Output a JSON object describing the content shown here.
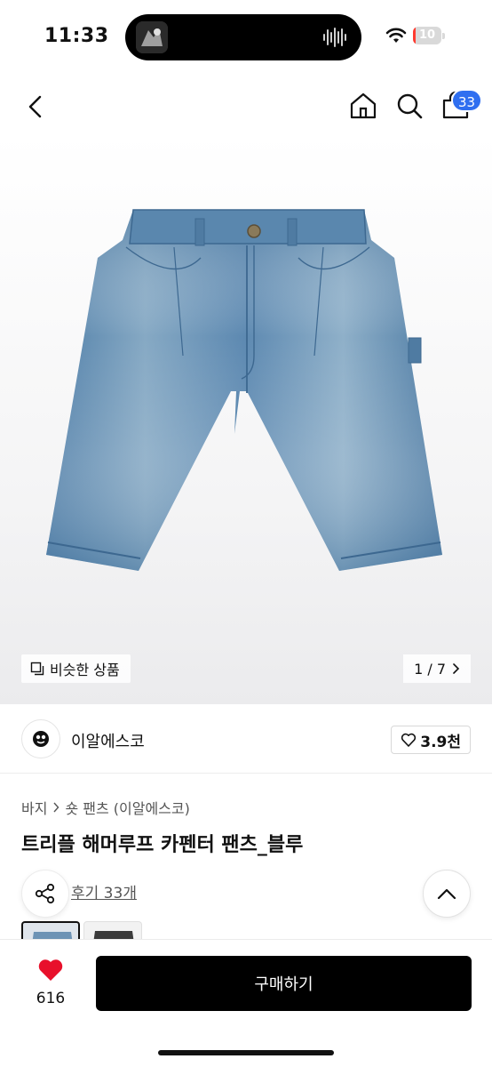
{
  "status_bar": {
    "time": "11:33",
    "battery": "10",
    "battery_level": 0.1
  },
  "nav": {
    "cart_count": "33",
    "icons": [
      "back-icon",
      "home-icon",
      "search-icon",
      "cart-icon"
    ]
  },
  "gallery": {
    "similar_label": "비슷한 상품",
    "counter": "1 / 7"
  },
  "brand": {
    "name": "이알에스코",
    "likes": "3.9천"
  },
  "product": {
    "breadcrumb": [
      "바지",
      "숏 팬츠 (이알에스코)"
    ],
    "title": "트리플 해머루프 카펜터 팬츠_블루",
    "reviews": "후기 33개"
  },
  "bottom": {
    "wish_count": "616",
    "buy_label": "구매하기"
  },
  "colors": {
    "accent": "#2f6ff0",
    "heart": "#e8102b",
    "buy_button": "#000000"
  }
}
